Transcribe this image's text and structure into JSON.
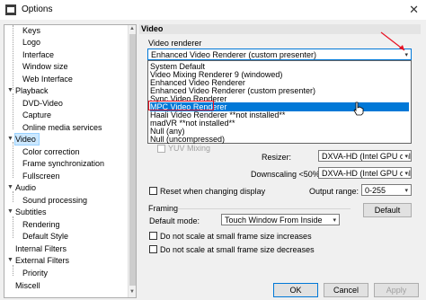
{
  "window": {
    "title": "Options",
    "close_glyph": "✕",
    "app_icon": "options-icon"
  },
  "tree": {
    "items": [
      {
        "label": "Keys",
        "level": 2
      },
      {
        "label": "Logo",
        "level": 2
      },
      {
        "label": "Interface",
        "level": 2
      },
      {
        "label": "Window size",
        "level": 2
      },
      {
        "label": "Web Interface",
        "level": 2
      },
      {
        "label": "Playback",
        "level": 1,
        "expanded": true
      },
      {
        "label": "DVD-Video",
        "level": 2
      },
      {
        "label": "Capture",
        "level": 2
      },
      {
        "label": "Online media services",
        "level": 2
      },
      {
        "label": "Video",
        "level": 1,
        "expanded": true,
        "selected": true
      },
      {
        "label": "Color correction",
        "level": 2
      },
      {
        "label": "Frame synchronization",
        "level": 2
      },
      {
        "label": "Fullscreen",
        "level": 2
      },
      {
        "label": "Audio",
        "level": 1,
        "expanded": true
      },
      {
        "label": "Sound processing",
        "level": 2
      },
      {
        "label": "Subtitles",
        "level": 1,
        "expanded": true
      },
      {
        "label": "Rendering",
        "level": 2
      },
      {
        "label": "Default Style",
        "level": 2
      },
      {
        "label": "Internal Filters",
        "level": 1
      },
      {
        "label": "External Filters",
        "level": 1,
        "expanded": true
      },
      {
        "label": "Priority",
        "level": 2
      },
      {
        "label": "Miscell",
        "level": 1
      }
    ]
  },
  "section": {
    "title": "Video"
  },
  "video_renderer": {
    "label": "Video renderer",
    "selected": "Enhanced Video Renderer (custom presenter)",
    "options": [
      "System Default",
      "Video Mixing Renderer 9 (windowed)",
      "Enhanced Video Renderer",
      "Enhanced Video Renderer (custom presenter)",
      "Sync Video Renderer",
      "MPC Video Renderer",
      "Haali Video Renderer **not installed**",
      "madVR **not installed**",
      "Null (any)",
      "Null (uncompressed)"
    ],
    "highlighted_index": 5
  },
  "yuv_mixing": {
    "label": "YUV Mixing"
  },
  "resizer": {
    "label": "Resizer:",
    "value": "DXVA-HD (Intel GPU only"
  },
  "downscaling": {
    "label": "Downscaling <50%:",
    "value": "DXVA-HD (Intel GPU only"
  },
  "reset_checkbox": {
    "label": "Reset when changing display"
  },
  "output_range": {
    "label": "Output range:",
    "value": "0-255"
  },
  "default_button": {
    "label": "Default"
  },
  "framing": {
    "title": "Framing",
    "mode_label": "Default mode:",
    "mode_value": "Touch Window From Inside",
    "no_scale_increase": "Do not scale at small frame size increases",
    "no_scale_decrease": "Do not scale at small frame size decreases"
  },
  "footer": {
    "ok": "OK",
    "cancel": "Cancel",
    "apply": "Apply"
  },
  "colors": {
    "accent": "#0078d7",
    "highlight_box": "#e81123",
    "selection": "#cce8ff"
  }
}
